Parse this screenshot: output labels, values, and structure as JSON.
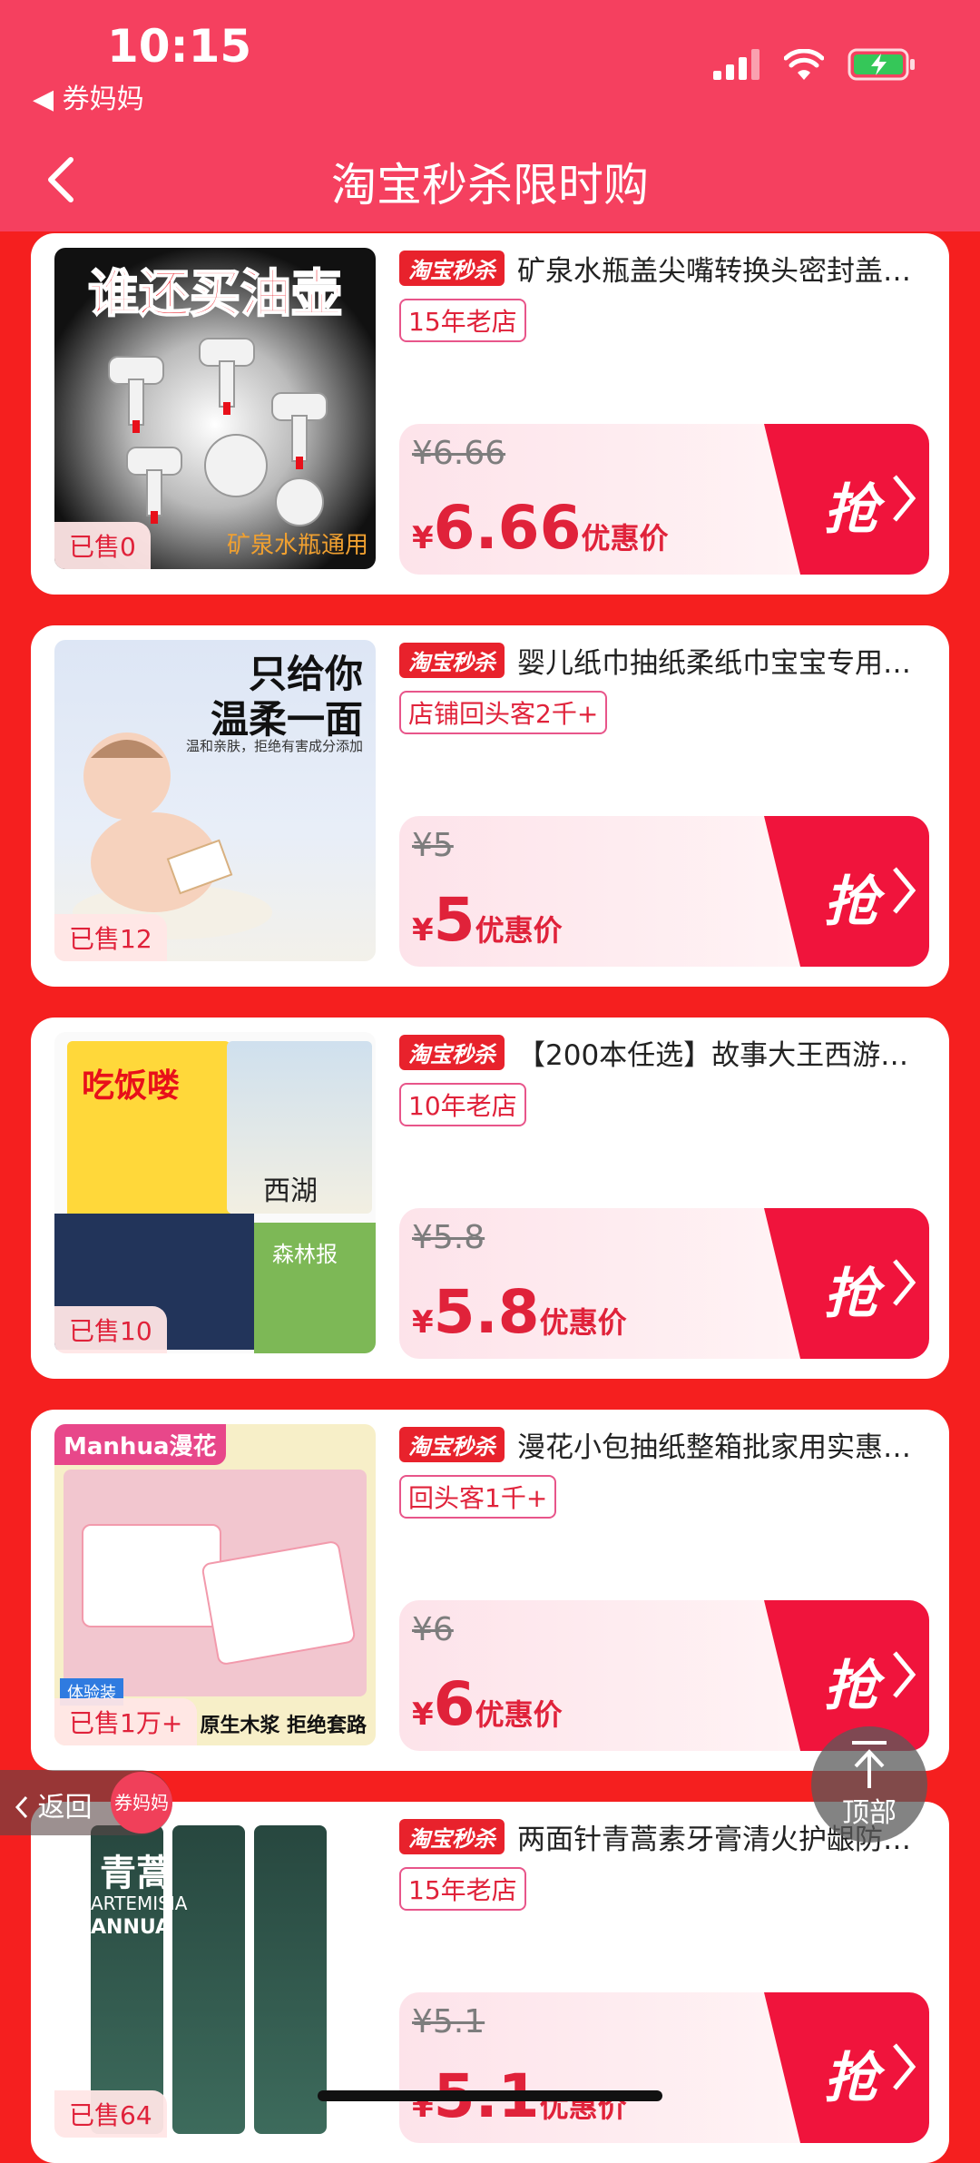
{
  "status": {
    "time": "10:15",
    "back_app": "◀ 券妈妈"
  },
  "header": {
    "title": "淘宝秒杀限时购"
  },
  "tag_label": "淘宝秒杀",
  "grab_label": "抢",
  "price_suffix": "优惠价",
  "products": [
    {
      "title": "矿泉水瓶盖尖嘴转换头密封盖…",
      "badge": "15年老店",
      "old_price": "¥6.66",
      "currency": "¥",
      "price": "6.66",
      "sold": "已售0",
      "image_text_top": "谁还买油壶",
      "image_text_bottom": "矿泉水瓶通用"
    },
    {
      "title": "婴儿纸巾抽纸柔纸巾宝宝专用…",
      "badge": "店铺回头客2千+",
      "old_price": "¥5",
      "currency": "¥",
      "price": "5",
      "sold": "已售12",
      "image_text_top": "只给你",
      "image_text_mid": "温柔一面",
      "image_text_small": "温和亲肤，拒绝有害成分添加"
    },
    {
      "title": "【200本任选】故事大王西游…",
      "badge": "10年老店",
      "old_price": "¥5.8",
      "currency": "¥",
      "price": "5.8",
      "sold": "已售10",
      "image_text_top": "吃饭喽",
      "image_text_mid": "西湖",
      "image_text_small": "森林报"
    },
    {
      "title": "漫花小包抽纸整箱批家用实惠…",
      "badge": "回头客1千+",
      "old_price": "¥6",
      "currency": "¥",
      "price": "6",
      "sold": "已售1万+",
      "image_text_top": "Manhua漫花",
      "image_text_mid": "体验装",
      "image_text_small": "原生木浆 拒绝套路"
    },
    {
      "title": "两面针青蒿素牙膏清火护龈防…",
      "badge": "15年老店",
      "old_price": "¥5.1",
      "currency": "¥",
      "price": "5.1",
      "sold": "已售64",
      "image_text_top": "青蒿",
      "image_text_mid": "ARTEMISIA",
      "image_text_small": "ANNUA"
    }
  ],
  "float_back": {
    "label": "返回",
    "logo": "券妈妈"
  },
  "to_top": {
    "label": "顶部"
  }
}
